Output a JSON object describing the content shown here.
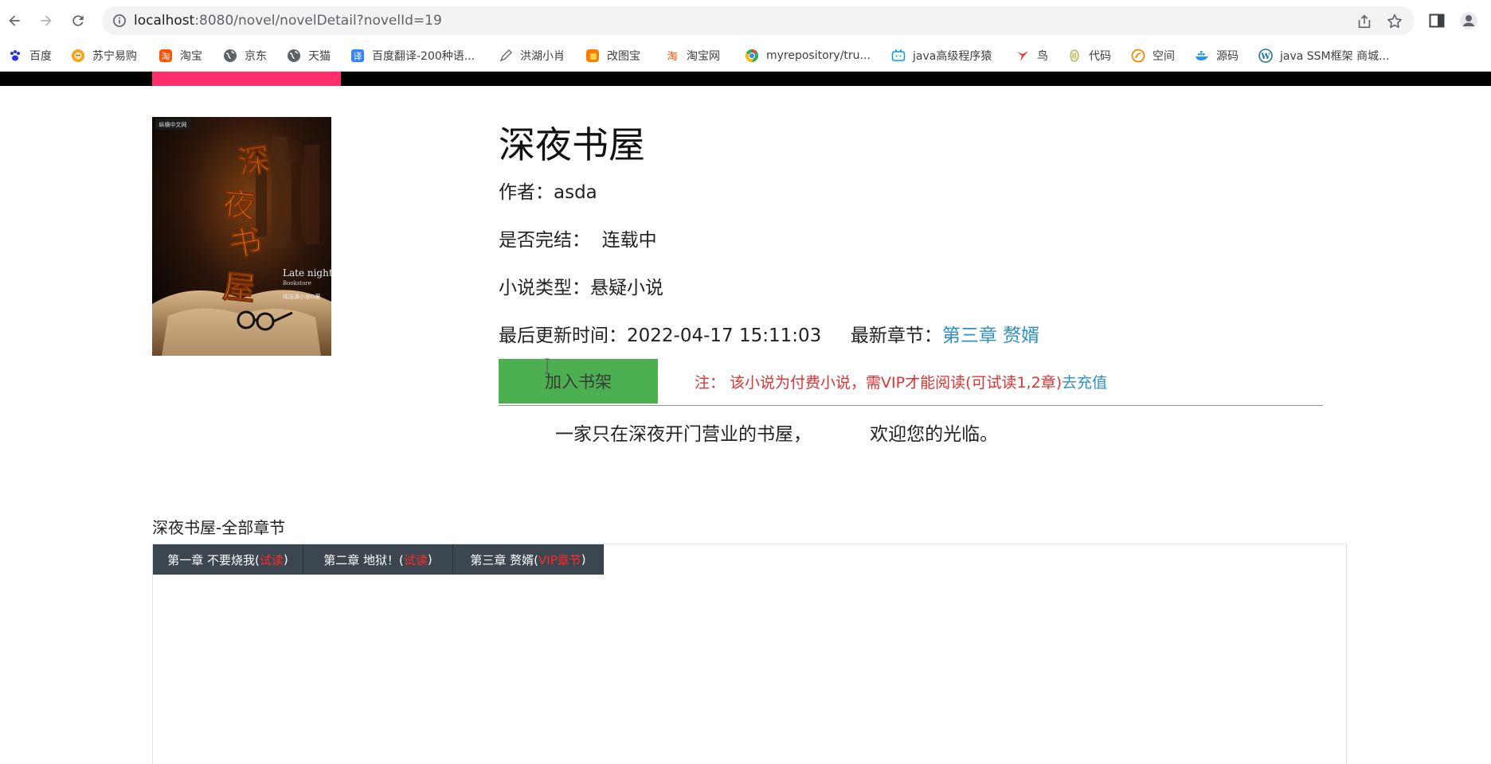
{
  "browser": {
    "url_host": "localhost",
    "url_path": ":8080/novel/novelDetail?novelId=19"
  },
  "bookmarks": [
    {
      "label": "百度",
      "icon": "paw-icon",
      "color": "#2932e1"
    },
    {
      "label": "苏宁易购",
      "icon": "lion-icon",
      "color": "#f7a21b"
    },
    {
      "label": "淘宝",
      "icon": "taobao-icon",
      "color": "#ff5000"
    },
    {
      "label": "京东",
      "icon": "globe-icon",
      "color": "#5f6368"
    },
    {
      "label": "天猫",
      "icon": "globe-icon",
      "color": "#5f6368"
    },
    {
      "label": "百度翻译-200种语...",
      "icon": "translate-icon",
      "color": "#3385ff"
    },
    {
      "label": "洪湖小肖",
      "icon": "pen-icon",
      "color": "#6a6a6a"
    },
    {
      "label": "改图宝",
      "icon": "square-icon",
      "color": "#ff7b00"
    },
    {
      "label": "淘宝网",
      "icon": "taobao-icon",
      "color": "#ff5000"
    },
    {
      "label": "myrepository/tru...",
      "icon": "chrome-icon",
      "color": "#34a853"
    },
    {
      "label": "java高级程序猿",
      "icon": "bilibili-icon",
      "color": "#00a1d6"
    },
    {
      "label": "鸟",
      "icon": "bird-icon",
      "color": "#e52d27"
    },
    {
      "label": "代码",
      "icon": "code-icon",
      "color": "#9e9e55"
    },
    {
      "label": "空间",
      "icon": "space-icon",
      "color": "#f08a00"
    },
    {
      "label": "源码",
      "icon": "docker-icon",
      "color": "#2496ed"
    },
    {
      "label": "java SSM框架 商城...",
      "icon": "wordpress-icon",
      "color": "#21759b"
    }
  ],
  "novel": {
    "title": "深夜书屋",
    "author_label": "作者：",
    "author": "asda",
    "status_label": "是否完结：",
    "status": "连载中",
    "type_label": "小说类型：",
    "type": "悬疑小说",
    "updated_label": "最后更新时间：",
    "updated": "2022-04-17 15:11:03",
    "latest_label": "最新章节：",
    "latest_chapter": "第三章 赘婿",
    "add_shelf": "加入书架",
    "note": "注：  该小说为付费小说，需VIP才能阅读(可试读1,2章)",
    "recharge": "去充值",
    "intro_part1": "一家只在深夜开门营业的书屋，",
    "intro_part2": "欢迎您的光临。",
    "cover_text": {
      "title_art": "深夜书屋",
      "english": "Late night",
      "english_sub": "Bookstore",
      "publisher_badge": "纵横中文网",
      "author": "纯洁滴小龙O著"
    }
  },
  "chapters": {
    "title": "深夜书屋-全部章节",
    "items": [
      {
        "name": "第一章 不要烧我(",
        "tag": "试读",
        "close": ")"
      },
      {
        "name": "第二章 地狱！(",
        "tag": "试读",
        "close": ")"
      },
      {
        "name": "第三章 赘婿(",
        "tag": "VIP章节",
        "close": ")"
      }
    ]
  },
  "colors": {
    "nav_active": "#ff2f6e",
    "button_green": "#4caf50",
    "link_blue": "#2e8ec8",
    "warning_red": "#d33",
    "tab_dark": "#3c4650"
  }
}
